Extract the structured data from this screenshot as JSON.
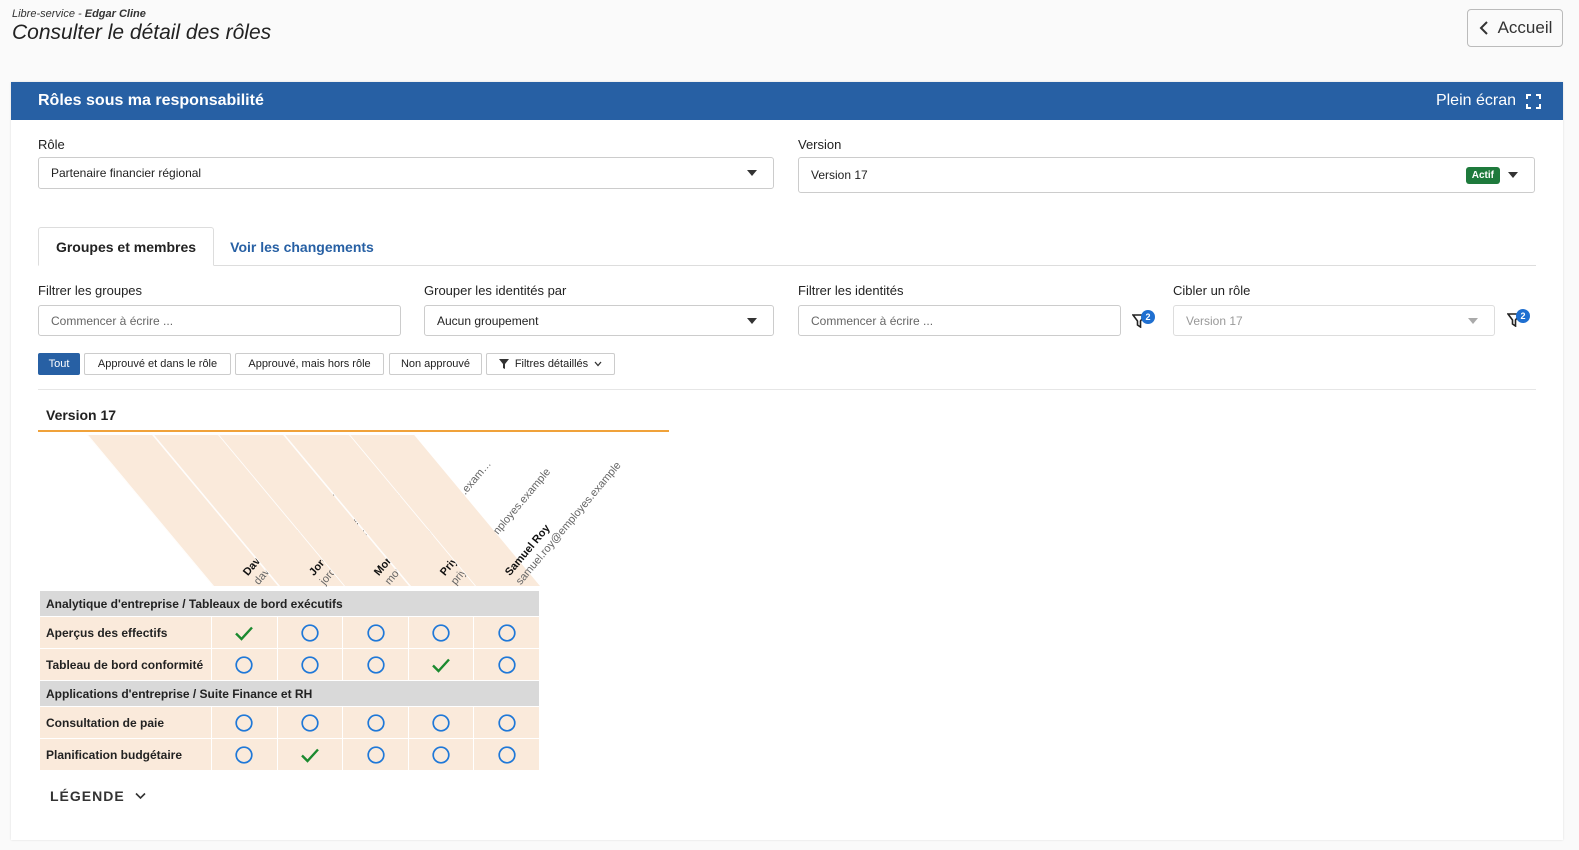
{
  "header": {
    "breadcrumb_prefix": "Libre-service - ",
    "breadcrumb_user": "Edgar Cline",
    "title": "Consulter le détail des rôles",
    "home_label": "Accueil"
  },
  "panel": {
    "title": "Rôles sous ma responsabilité",
    "fullscreen_label": "Plein écran"
  },
  "role": {
    "label": "Rôle",
    "value": "Partenaire financier régional"
  },
  "version": {
    "label": "Version",
    "value": "Version 17",
    "badge": "Actif"
  },
  "tabs": [
    {
      "label": "Groupes et membres",
      "active": true
    },
    {
      "label": "Voir les changements",
      "active": false
    }
  ],
  "filters": {
    "groups": {
      "label": "Filtrer les groupes",
      "placeholder": "Commencer à écrire ..."
    },
    "group_by": {
      "label": "Grouper les identités par",
      "value": "Aucun groupement"
    },
    "identities": {
      "label": "Filtrer les identités",
      "placeholder": "Commencer à écrire ...",
      "filter_count": "2"
    },
    "target_role": {
      "label": "Cibler un rôle",
      "value": "Version 17",
      "filter_count": "2"
    }
  },
  "chips": [
    {
      "label": "Tout",
      "active": true
    },
    {
      "label": "Approuvé et dans le rôle",
      "active": false
    },
    {
      "label": "Approuvé, mais hors rôle",
      "active": false
    },
    {
      "label": "Non approuvé",
      "active": false
    },
    {
      "label": "Filtres détaillés",
      "active": false
    }
  ],
  "matrix": {
    "version_title": "Version 17",
    "people": [
      {
        "name": "David Walsh",
        "email": "david.walsh@employes.example"
      },
      {
        "name": "Jordan Mercer",
        "email": "jordan.mercer@employes.exam..."
      },
      {
        "name": "Morgan Ellis",
        "email": "morgan.ellis@employes.example"
      },
      {
        "name": "Priya Nair",
        "email": "priya.nair@employes.example"
      },
      {
        "name": "Samuel Roy",
        "email": "samuel.roy@employes.example"
      }
    ],
    "groups": [
      {
        "title": "Analytique d'entreprise / Tableaux de bord exécutifs",
        "rows": [
          {
            "label": "Aperçus des effectifs",
            "cells": [
              "check",
              "circle",
              "circle",
              "circle",
              "circle"
            ]
          },
          {
            "label": "Tableau de bord conformité",
            "cells": [
              "circle",
              "circle",
              "circle",
              "check",
              "circle"
            ]
          }
        ]
      },
      {
        "title": "Applications d'entreprise / Suite Finance et RH",
        "rows": [
          {
            "label": "Consultation de paie",
            "cells": [
              "circle",
              "circle",
              "circle",
              "circle",
              "circle"
            ]
          },
          {
            "label": "Planification budgétaire",
            "cells": [
              "circle",
              "check",
              "circle",
              "circle",
              "circle"
            ]
          }
        ]
      }
    ]
  },
  "legend_label": "LÉGENDE",
  "colors": {
    "primary": "#2760a4",
    "check": "#1b8a2f",
    "circle": "#1f78d8",
    "active_badge": "#1e7a3c",
    "accent": "#f0a23a"
  }
}
